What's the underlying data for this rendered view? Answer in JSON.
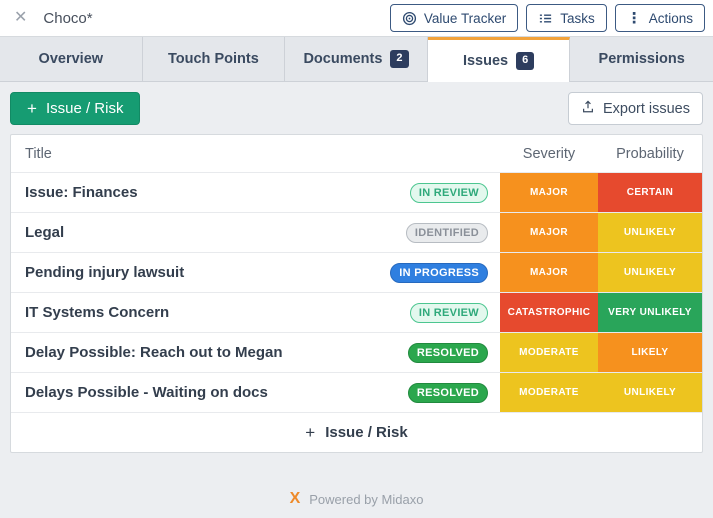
{
  "topbar": {
    "title": "Choco*",
    "close_glyph": "✕",
    "buttons": [
      {
        "label": "Value Tracker"
      },
      {
        "label": "Tasks"
      },
      {
        "label": "Actions"
      }
    ],
    "kebab_glyph": "⋮"
  },
  "tabs": [
    {
      "label": "Overview"
    },
    {
      "label": "Touch Points"
    },
    {
      "label": "Documents",
      "badge": "2"
    },
    {
      "label": "Issues",
      "badge": "6",
      "active": true
    },
    {
      "label": "Permissions"
    }
  ],
  "toolbar": {
    "plus": "+",
    "add_button": "Issue / Risk",
    "export_button": "Export issues"
  },
  "table": {
    "columns": [
      "Title",
      "Severity",
      "Probability"
    ],
    "rows": [
      {
        "title": "Issue: Finances",
        "status": "IN REVIEW",
        "status_key": "in-review",
        "severity": "MAJOR",
        "severity_color": "orange",
        "probability": "CERTAIN",
        "probability_color": "red"
      },
      {
        "title": "Legal",
        "status": "IDENTIFIED",
        "status_key": "identified",
        "severity": "MAJOR",
        "severity_color": "orange",
        "probability": "UNLIKELY",
        "probability_color": "yellow"
      },
      {
        "title": "Pending injury lawsuit",
        "status": "IN PROGRESS",
        "status_key": "in-progress",
        "severity": "MAJOR",
        "severity_color": "orange",
        "probability": "UNLIKELY",
        "probability_color": "yellow"
      },
      {
        "title": "IT Systems Concern",
        "status": "IN REVIEW",
        "status_key": "in-review",
        "severity": "CATASTROPHIC",
        "severity_color": "red",
        "probability": "VERY UNLIKELY",
        "probability_color": "green"
      },
      {
        "title": "Delay Possible: Reach out to Megan",
        "status": "RESOLVED",
        "status_key": "resolved",
        "severity": "MODERATE",
        "severity_color": "yellow",
        "probability": "LIKELY",
        "probability_color": "orange"
      },
      {
        "title": "Delays Possible - Waiting on docs",
        "status": "RESOLVED",
        "status_key": "resolved",
        "severity": "MODERATE",
        "severity_color": "yellow",
        "probability": "UNLIKELY",
        "probability_color": "yellow"
      }
    ],
    "add_row_label": "Issue / Risk"
  },
  "footer": {
    "logo_glyph": "X",
    "powered_by": "Powered by Midaxo"
  },
  "colors": {
    "tab_accent_orange": "#F2A33C",
    "brand_green": "#169C72",
    "badge_navy": "#2D3D5E",
    "ratings": {
      "orange": "#F6911E",
      "red": "#E64A2E",
      "yellow": "#EDC41F",
      "green": "#29A55A"
    },
    "status": {
      "in_review": {
        "bg": "#E3F8EE",
        "border": "#4CC690",
        "text": "#2FA97B"
      },
      "identified": {
        "bg": "#E9EBED",
        "border": "#B7BCC2",
        "text": "#8A9099"
      },
      "in_progress": {
        "bg": "#2F7FE0",
        "border": "#2669BE",
        "text": "#FFFFFF"
      },
      "resolved": {
        "bg": "#2BA74D",
        "border": "#218A3E",
        "text": "#FFFFFF"
      }
    }
  }
}
